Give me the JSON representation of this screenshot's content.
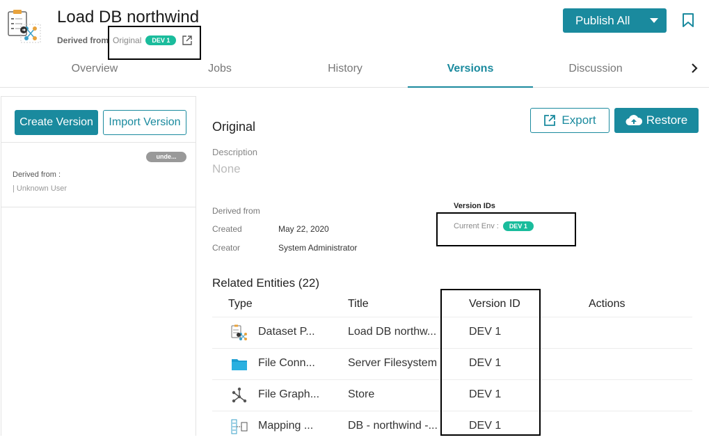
{
  "header": {
    "title": "Load DB northwind",
    "derived_label": "Derived from",
    "derived_value": "Original",
    "derived_badge": "DEV 1",
    "publish_label": "Publish All"
  },
  "tabs": [
    {
      "label": "Overview"
    },
    {
      "label": "Jobs"
    },
    {
      "label": "History"
    },
    {
      "label": "Versions"
    },
    {
      "label": "Discussion"
    }
  ],
  "left_panel": {
    "create_label": "Create Version",
    "import_label": "Import Version",
    "card": {
      "status": "unde...",
      "derived_from": "Derived from :",
      "user": "| Unknown User"
    }
  },
  "detail": {
    "export_label": "Export",
    "restore_label": "Restore",
    "title": "Original",
    "description_label": "Description",
    "description_value": "None",
    "derived_from_label": "Derived from",
    "created_label": "Created",
    "created_value": "May 22, 2020",
    "creator_label": "Creator",
    "creator_value": "System Administrator",
    "version_ids_title": "Version IDs",
    "current_env_label": "Current Env :",
    "current_env_badge": "DEV 1"
  },
  "related": {
    "title": "Related Entities (22)",
    "columns": [
      "Type",
      "Title",
      "Version ID",
      "Actions"
    ],
    "rows": [
      {
        "icon": "dataset-pipeline-icon",
        "type": "Dataset P...",
        "title": "Load DB northw...",
        "version": "DEV 1"
      },
      {
        "icon": "folder-icon",
        "type": "File Conn...",
        "title": "Server Filesystem",
        "version": "DEV 1"
      },
      {
        "icon": "graph-icon",
        "type": "File Graph...",
        "title": "Store",
        "version": "DEV 1"
      },
      {
        "icon": "mapping-icon",
        "type": "Mapping ...",
        "title": "DB - northwind -...",
        "version": "DEV 1"
      }
    ]
  },
  "colors": {
    "accent": "#1a8a9e",
    "badge": "#1abc9c"
  }
}
